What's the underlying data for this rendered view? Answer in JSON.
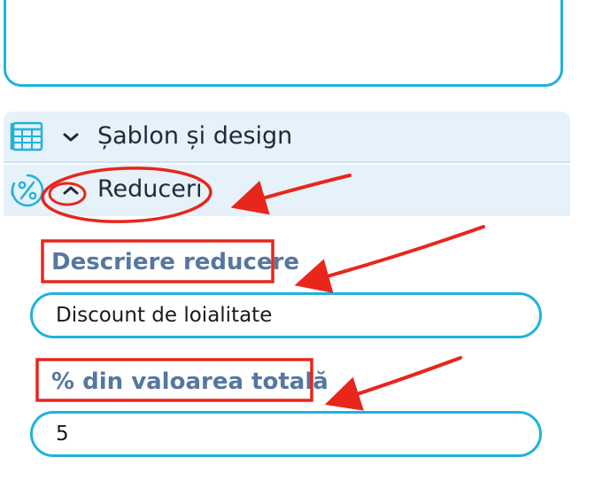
{
  "sections": {
    "sablon": {
      "label": "Șablon și design",
      "icon": "table-icon",
      "expanded": false
    },
    "reduceri": {
      "label": "Reduceri",
      "icon": "percent-icon",
      "expanded": true
    }
  },
  "discount_form": {
    "description_label": "Descriere reducere",
    "description_value": "Discount de loialitate",
    "percent_label": "% din valoarea totală",
    "percent_value": "5"
  },
  "colors": {
    "accent": "#1eb3dd",
    "label": "#5577a0",
    "section_bg": "#e6f1f9",
    "annotation": "#e8261c"
  }
}
